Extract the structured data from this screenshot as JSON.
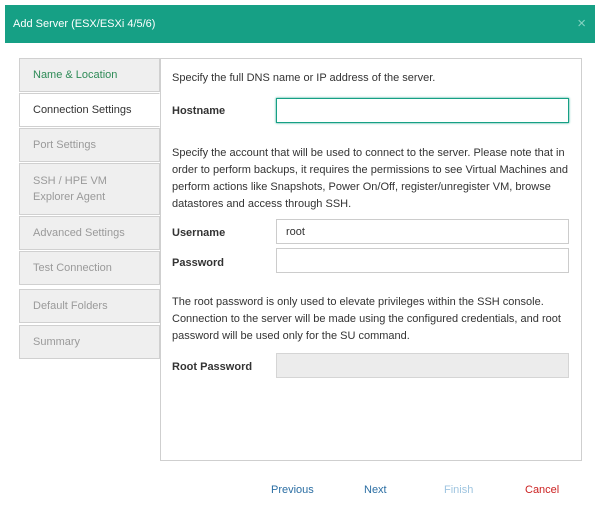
{
  "dialog": {
    "title": "Add Server (ESX/ESXi 4/5/6)",
    "close_glyph": "×"
  },
  "nav": {
    "items": [
      {
        "label": "Name & Location",
        "state": "completed"
      },
      {
        "label": "Connection Settings",
        "state": "active"
      },
      {
        "label": "Port Settings",
        "state": "disabled"
      },
      {
        "label": "SSH / HPE VM Explorer Agent",
        "state": "disabled"
      },
      {
        "label": "Advanced Settings",
        "state": "disabled"
      },
      {
        "label": "Test Connection",
        "state": "disabled"
      },
      {
        "label": "Default Folders",
        "state": "disabled"
      },
      {
        "label": "Summary",
        "state": "disabled"
      }
    ]
  },
  "connection": {
    "intro_text": "Specify the full DNS name or IP address of the server.",
    "hostname_label": "Hostname",
    "hostname_value": "",
    "account_text": "Specify the account that will be used to connect to the server. Please note that in order to perform backups, it requires the permissions to see Virtual Machines and perform actions like Snapshots, Power On/Off, register/unregister VM, browse datastores and access through SSH.",
    "username_label": "Username",
    "username_value": "root",
    "password_label": "Password",
    "password_value": "",
    "root_text": "The root password is only used to elevate privileges within the SSH console. Connection to the server will be made using the configured credentials, and root password will be used only for the SU command.",
    "root_password_label": "Root Password",
    "root_password_value": ""
  },
  "footer": {
    "previous": "Previous",
    "next": "Next",
    "finish": "Finish",
    "cancel": "Cancel"
  },
  "colors": {
    "header": "#16a085",
    "link": "#2b6ea3",
    "cancel": "#cc2222",
    "finish_disabled": "#9fc5e0"
  }
}
